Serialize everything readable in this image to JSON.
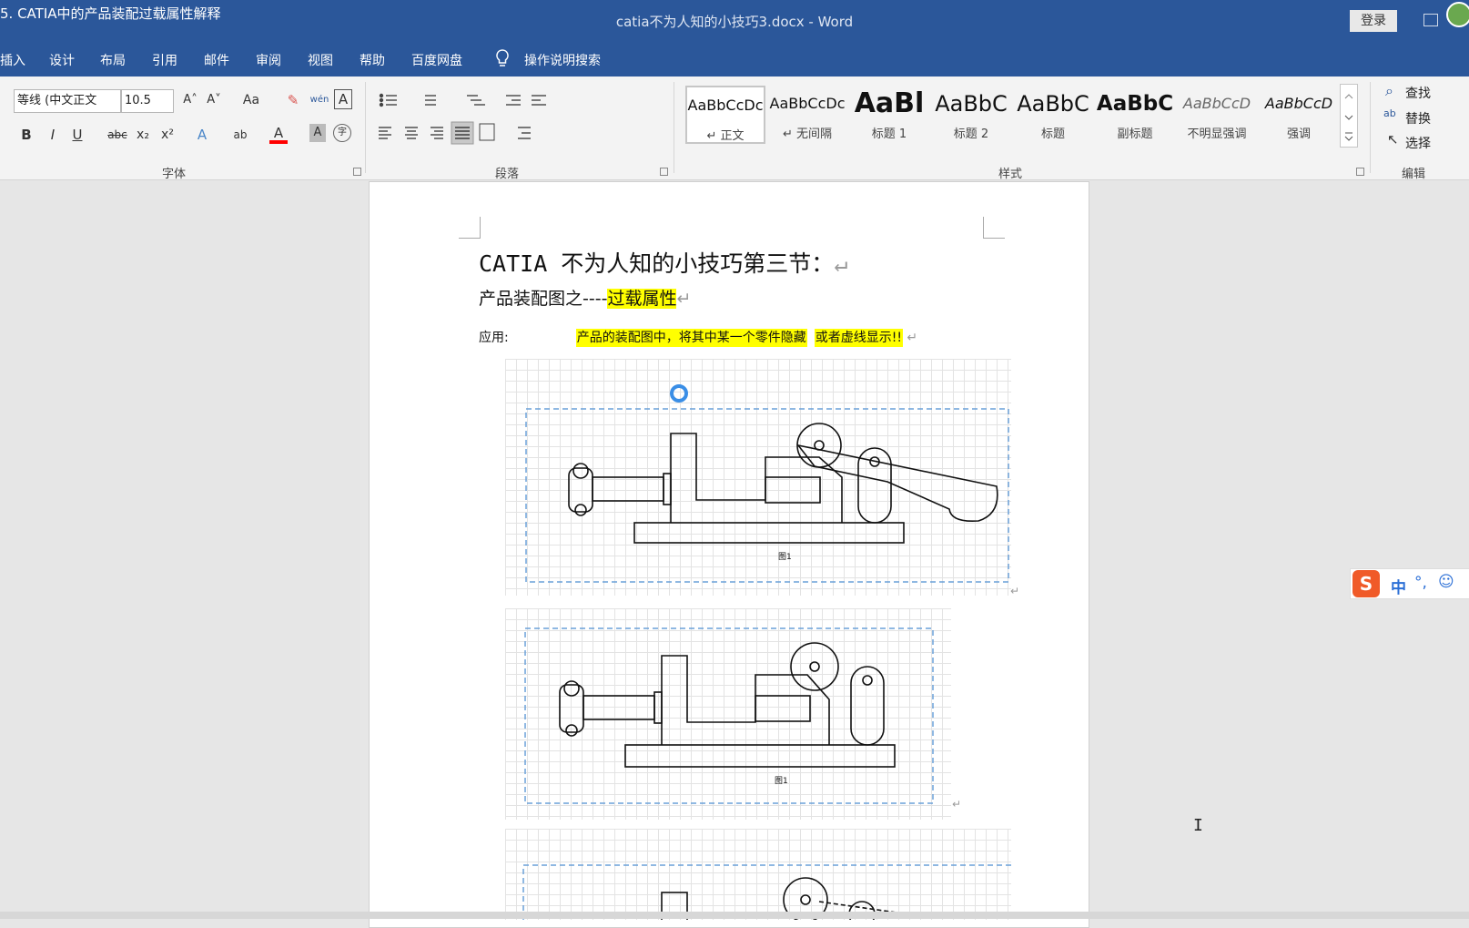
{
  "window": {
    "video_title": "5. CATIA中的产品装配过载属性解释",
    "doc_title": "catia不为人知的小技巧3.docx  -  Word",
    "login_label": "登录"
  },
  "menu": {
    "tabs": [
      "插入",
      "设计",
      "布局",
      "引用",
      "邮件",
      "审阅",
      "视图",
      "帮助",
      "百度网盘"
    ],
    "search_label": "操作说明搜索"
  },
  "ribbon": {
    "font_name": "等线 (中文正文",
    "font_size": "10.5",
    "font_group": "字体",
    "paragraph_group": "段落",
    "styles_group": "样式",
    "edit_group": "编辑",
    "font_buttons": {
      "grow": "A˄",
      "shrink": "A˅",
      "case": "Aa",
      "phonetic": "wén",
      "border_char": "A",
      "bold": "B",
      "italic": "I",
      "underline": "U",
      "strike": "abc",
      "sub": "x₂",
      "sup": "x²",
      "effects": "A",
      "highlight": "ab",
      "color": "A",
      "shade": "A",
      "enclose": "字"
    },
    "styles": [
      {
        "preview": "AaBbCcDc",
        "name": "↵ 正文"
      },
      {
        "preview": "AaBbCcDc",
        "name": "↵ 无间隔"
      },
      {
        "preview": "AaBl",
        "name": "标题 1"
      },
      {
        "preview": "AaBbC",
        "name": "标题 2"
      },
      {
        "preview": "AaBbC",
        "name": "标题"
      },
      {
        "preview": "AaBbC",
        "name": "副标题"
      },
      {
        "preview": "AaBbCcD",
        "name": "不明显强调"
      },
      {
        "preview": "AaBbCcD",
        "name": "强调"
      }
    ],
    "edit": {
      "find": "查找",
      "replace": "替换",
      "select": "选择"
    },
    "colors": {
      "title_bar": "#2b579a",
      "font_color_bar": "#ff0000",
      "highlight": "#ffff00"
    }
  },
  "document": {
    "heading": "CATIA 不为人知的小技巧第三节：",
    "subheading_prefix": "产品装配图之----",
    "subheading_highlight": "过载属性",
    "app_label": "应用:",
    "app_text_1": "产品的装配图中，将其中某一个零件隐藏",
    "app_text_2": "或者虚线显示!!",
    "return_mark": "↵",
    "caption": "图1"
  },
  "ime": {
    "logo": "S",
    "mode": "中",
    "punct": "°,",
    "emoji": "☺"
  }
}
